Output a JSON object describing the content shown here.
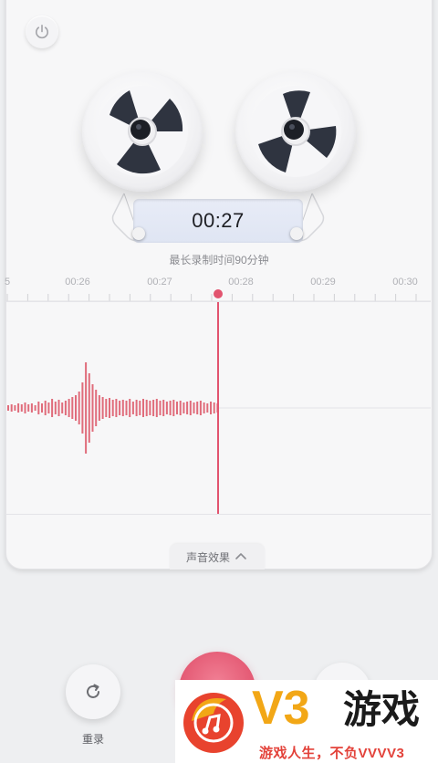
{
  "recorder": {
    "elapsed": "00:27",
    "max_duration_label": "最长录制时间90分钟",
    "playhead_time": "00:27.8"
  },
  "timeline": {
    "ticks": [
      "5",
      "00:26",
      "00:27",
      "00:28",
      "00:29",
      "00:30"
    ]
  },
  "effects": {
    "label": "声音效果",
    "icon": "chevron-up-icon"
  },
  "controls": {
    "rerecord_label": "重录",
    "rerecord_icon": "refresh-icon",
    "power_icon": "power-icon"
  },
  "colors": {
    "accent": "#e2546f",
    "waveform": "#e06c7b"
  },
  "watermark": {
    "brand": "V3",
    "brand_cn": "游戏",
    "slogan": "游戏人生，不负VVVV3"
  }
}
